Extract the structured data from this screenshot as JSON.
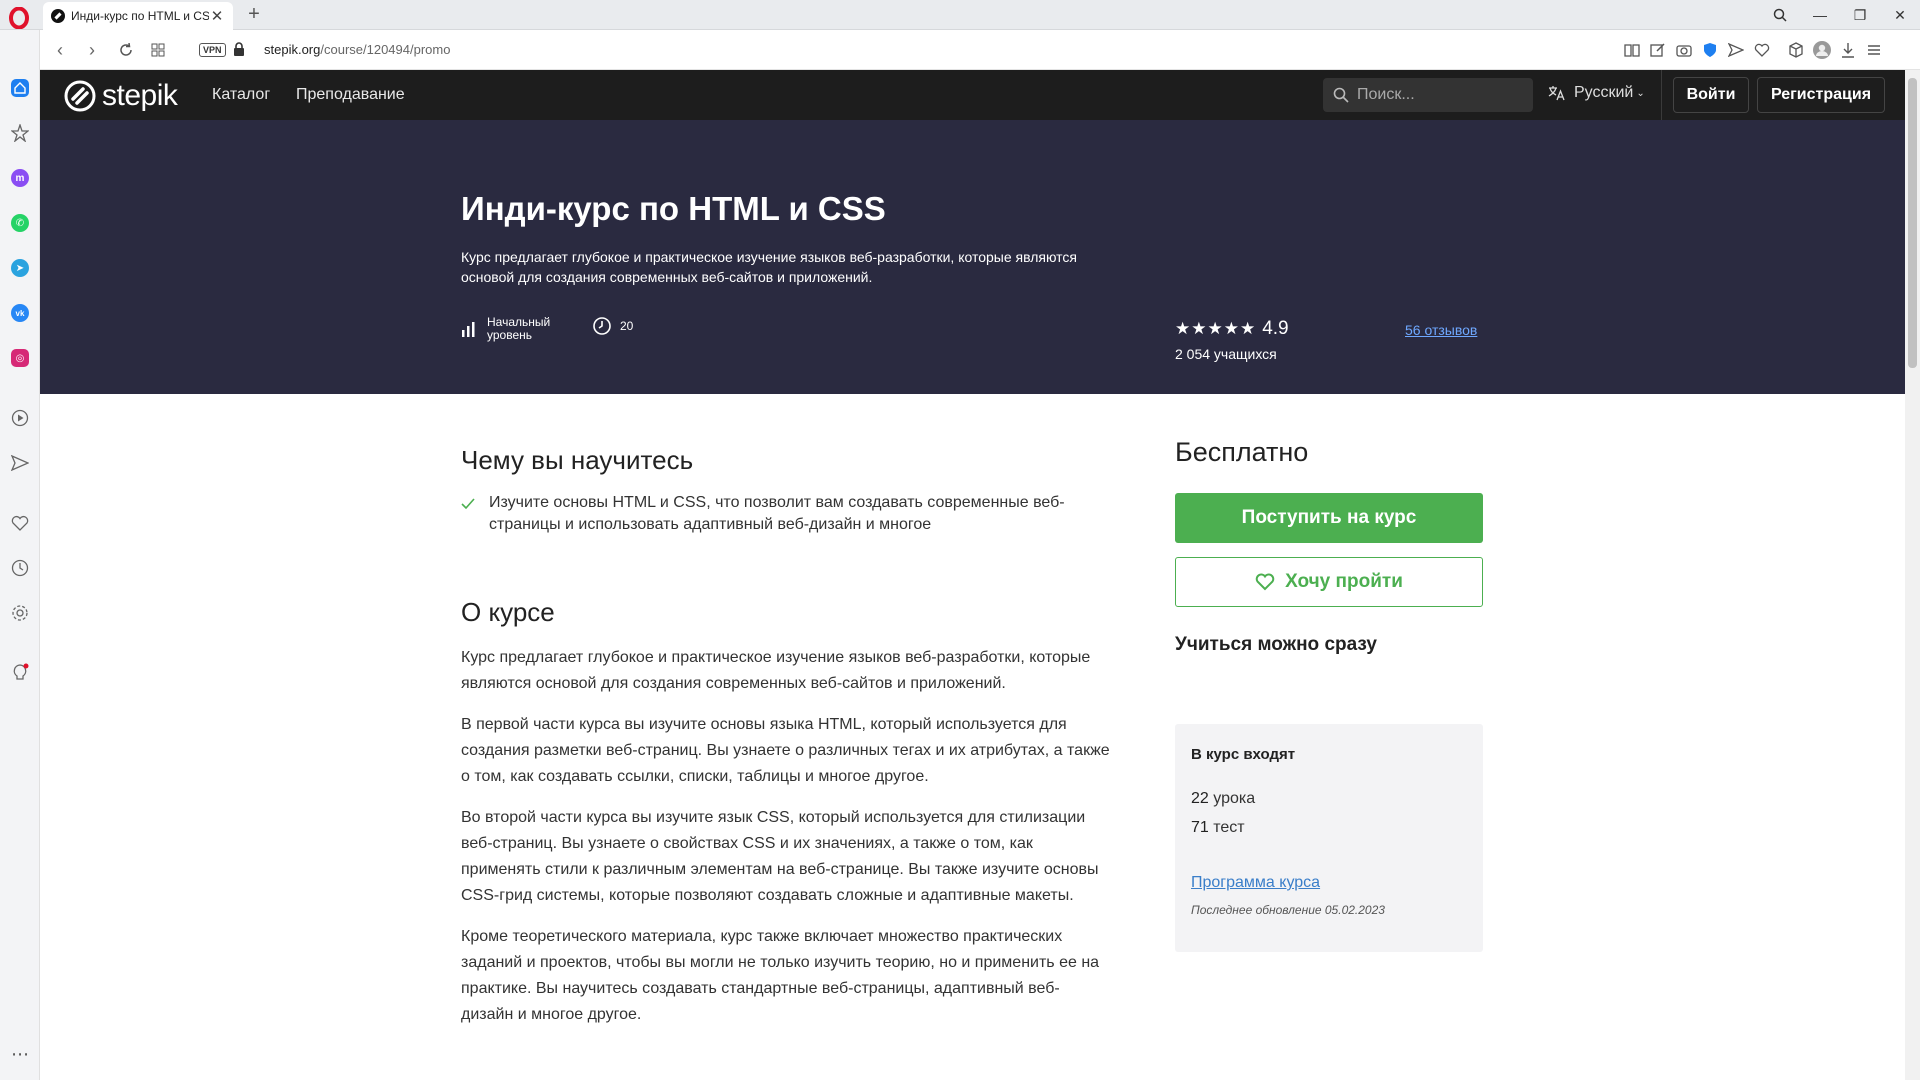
{
  "browser": {
    "tab_title": "Инди-курс по HTML и CSS",
    "url_host": "stepik.org",
    "url_path": "/course/120494/promo",
    "vpn_label": "VPN"
  },
  "site": {
    "brand": "stepik",
    "nav": [
      "Каталог",
      "Преподавание"
    ],
    "search_placeholder": "Поиск...",
    "language": "Русский",
    "login": "Войти",
    "register": "Регистрация"
  },
  "course": {
    "title": "Инди-курс по HTML и CSS",
    "description": "Курс предлагает глубокое и практическое изучение языков веб-разработки, которые являются основой для создания современных веб-сайтов и приложений.",
    "level_line1": "Начальный",
    "level_line2": "уровень",
    "hours": "20",
    "rating": "4.9",
    "stars_count": 5,
    "learners": "2 054 учащихся",
    "reviews": "56 отзывов"
  },
  "learn": {
    "heading": "Чему вы научитесь",
    "items": [
      "Изучите основы HTML и CSS, что позволит вам создавать современные веб-страницы и использовать адаптивный веб-дизайн и многое"
    ]
  },
  "about": {
    "heading": "О курсе",
    "paragraphs": [
      "Курс предлагает глубокое и практическое изучение языков веб-разработки, которые являются основой для создания современных веб-сайтов и приложений.",
      "В первой части курса вы изучите основы языка HTML, который используется для создания разметки веб-страниц. Вы узнаете о различных тегах и их атрибутах, а также о том, как создавать ссылки, списки, таблицы и многое другое.",
      "Во второй части курса вы изучите язык CSS, который используется для стилизации веб-страниц. Вы узнаете о свойствах CSS и их значениях, а также о том, как применять стили к различным элементам на веб-странице. Вы также изучите основы CSS-грид системы, которые позволяют создавать сложные и адаптивные макеты.",
      "Кроме теоретического материала, курс также включает множество практических заданий и проектов, чтобы вы могли не только изучить теорию, но и применить ее на практике. Вы научитесь создавать стандартные веб-страницы, адаптивный веб-дизайн и многое другое."
    ]
  },
  "sidebar_card": {
    "price": "Бесплатно",
    "enroll": "Поступить на курс",
    "wishlist": "Хочу пройти",
    "start_now": "Учиться можно сразу",
    "includes_title": "В курс входят",
    "lessons_num": "22",
    "lessons_word": "урока",
    "tests_num": "71",
    "tests_word": "тест",
    "program_link": "Программа курса",
    "updated": "Последнее обновление 05.02.2023"
  },
  "colors": {
    "hero_bg": "#2a2a40",
    "header_bg": "#1d1d1d",
    "accent_green": "#4caf50",
    "link_blue": "#3a7ec9"
  }
}
